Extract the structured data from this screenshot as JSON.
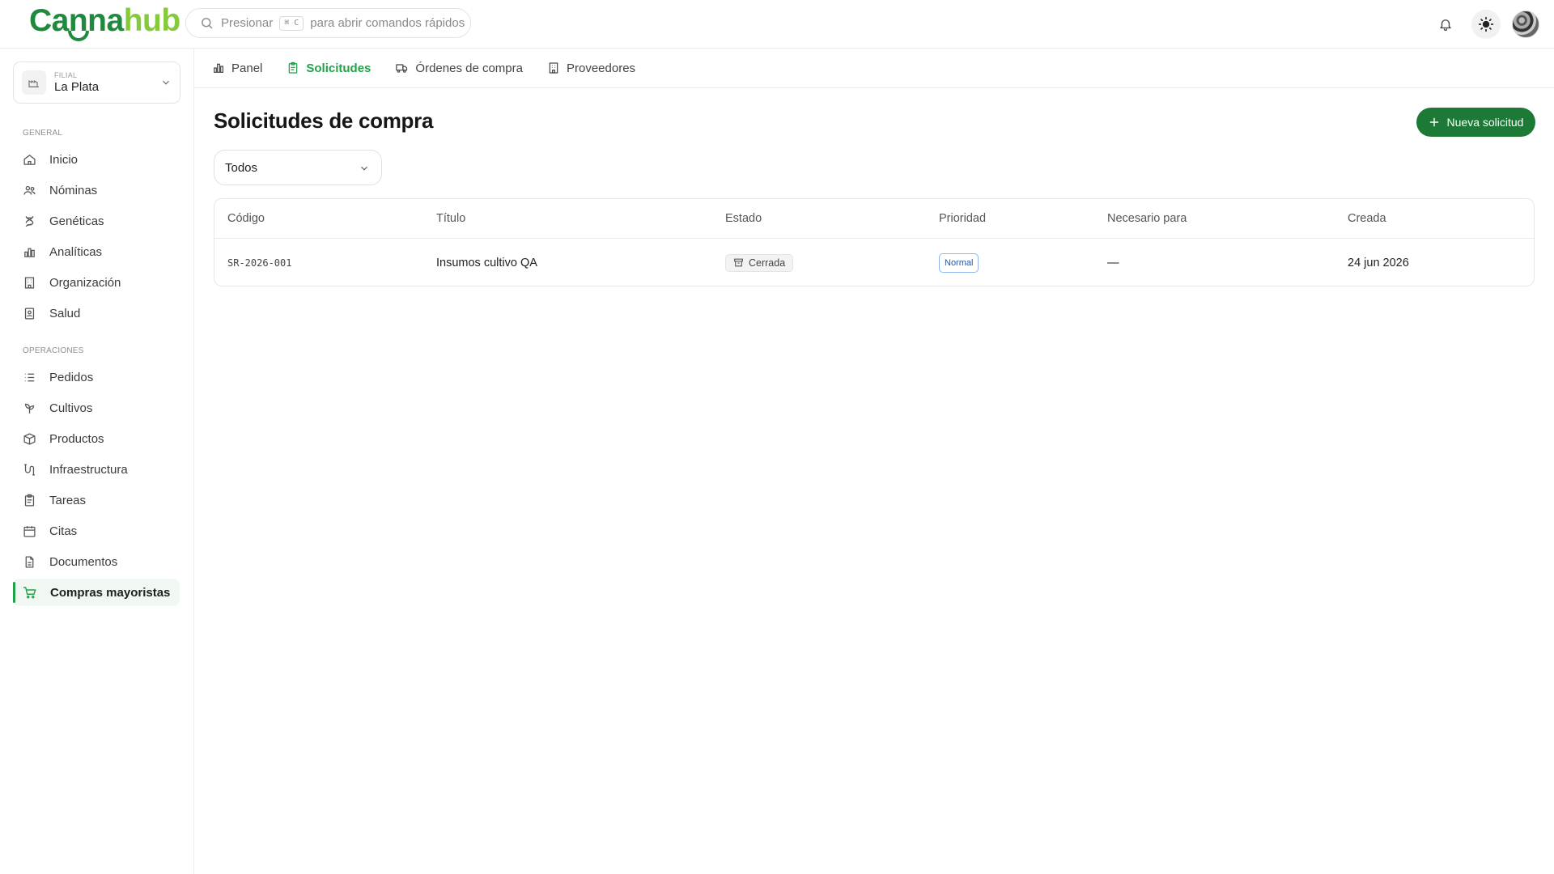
{
  "brand": {
    "logo_part1": "Canna",
    "logo_part2": "hub"
  },
  "search": {
    "prefix": "Presionar",
    "shortcut": "⌘ C",
    "suffix": "para abrir comandos rápidos"
  },
  "branch": {
    "label": "Filial",
    "name": "La Plata"
  },
  "sidebar": {
    "general_label": "General",
    "general": [
      {
        "label": "Inicio",
        "icon": "home-icon"
      },
      {
        "label": "Nóminas",
        "icon": "users-icon"
      },
      {
        "label": "Genéticas",
        "icon": "dna-icon"
      },
      {
        "label": "Analíticas",
        "icon": "bar-chart-icon"
      },
      {
        "label": "Organización",
        "icon": "building-icon"
      },
      {
        "label": "Salud",
        "icon": "id-badge-icon"
      }
    ],
    "operaciones_label": "Operaciones",
    "operaciones": [
      {
        "label": "Pedidos",
        "icon": "list-icon"
      },
      {
        "label": "Cultivos",
        "icon": "sprout-icon"
      },
      {
        "label": "Productos",
        "icon": "package-icon"
      },
      {
        "label": "Infraestructura",
        "icon": "pipes-icon"
      },
      {
        "label": "Tareas",
        "icon": "clipboard-icon"
      },
      {
        "label": "Citas",
        "icon": "calendar-icon"
      },
      {
        "label": "Documentos",
        "icon": "document-icon"
      },
      {
        "label": "Compras mayoristas",
        "icon": "cart-icon",
        "active": true
      }
    ]
  },
  "tabs": [
    {
      "label": "Panel",
      "icon": "bar-chart-icon"
    },
    {
      "label": "Solicitudes",
      "icon": "clipboard-icon",
      "active": true
    },
    {
      "label": "Órdenes de compra",
      "icon": "truck-icon"
    },
    {
      "label": "Proveedores",
      "icon": "building-icon"
    }
  ],
  "main": {
    "title": "Solicitudes de compra",
    "new_button": "Nueva solicitud",
    "filter_value": "Todos"
  },
  "table": {
    "headers": [
      "Código",
      "Título",
      "Estado",
      "Prioridad",
      "Necesario para",
      "Creada"
    ],
    "rows": [
      {
        "code": "SR-2026-001",
        "title": "Insumos cultivo QA",
        "status": "Cerrada",
        "priority": "Normal",
        "needed_for": "—",
        "created": "24 jun 2026"
      }
    ]
  },
  "colors": {
    "brand_dark": "#1f8a3d",
    "brand_light": "#86c93b",
    "accent": "#22a34a",
    "button": "#1c7a36"
  }
}
